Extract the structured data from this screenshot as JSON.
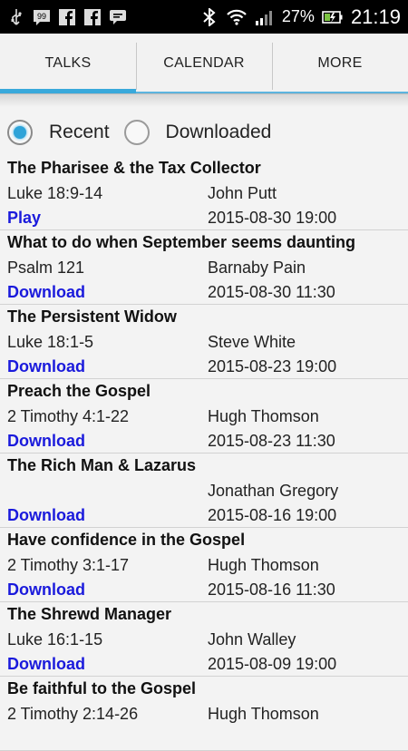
{
  "status_bar": {
    "battery": "27%",
    "time": "21:19"
  },
  "tabs": [
    {
      "label": "TALKS",
      "active": true
    },
    {
      "label": "CALENDAR",
      "active": false
    },
    {
      "label": "MORE",
      "active": false
    }
  ],
  "filter": {
    "recent_label": "Recent",
    "downloaded_label": "Downloaded",
    "selected": "Recent"
  },
  "talks": [
    {
      "title": "The Pharisee & the Tax Collector",
      "passage": "Luke 18:9-14",
      "speaker": "John Putt",
      "action": "Play",
      "datetime": "2015-08-30 19:00"
    },
    {
      "title": "What to do when September seems daunting",
      "passage": "Psalm 121",
      "speaker": "Barnaby Pain",
      "action": "Download",
      "datetime": "2015-08-30 11:30"
    },
    {
      "title": "The Persistent Widow",
      "passage": "Luke 18:1-5",
      "speaker": "Steve White",
      "action": "Download",
      "datetime": "2015-08-23 19:00"
    },
    {
      "title": "Preach the Gospel",
      "passage": "2 Timothy 4:1-22",
      "speaker": "Hugh Thomson",
      "action": "Download",
      "datetime": "2015-08-23 11:30"
    },
    {
      "title": "The Rich Man & Lazarus",
      "passage": "",
      "speaker": "Jonathan Gregory",
      "action": "Download",
      "datetime": "2015-08-16 19:00"
    },
    {
      "title": "Have confidence in the Gospel",
      "passage": "2 Timothy 3:1-17",
      "speaker": "Hugh Thomson",
      "action": "Download",
      "datetime": "2015-08-16 11:30"
    },
    {
      "title": "The Shrewd Manager",
      "passage": "Luke 16:1-15",
      "speaker": "John Walley",
      "action": "Download",
      "datetime": "2015-08-09 19:00"
    },
    {
      "title": "Be faithful to the Gospel",
      "passage": "2 Timothy 2:14-26",
      "speaker": "Hugh Thomson",
      "action": "",
      "datetime": ""
    }
  ]
}
